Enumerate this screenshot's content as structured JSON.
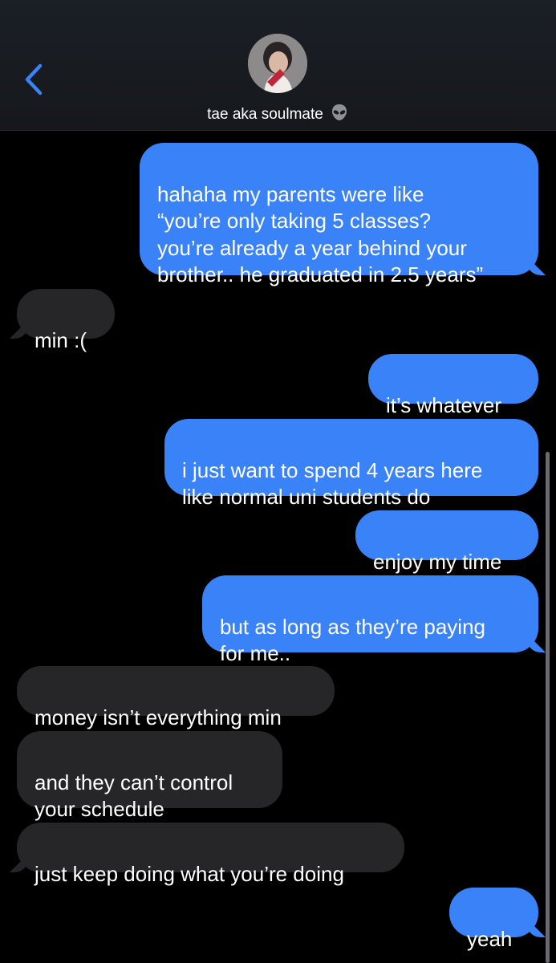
{
  "header": {
    "contact_name": "tae aka soulmate",
    "contact_emoji_icon": "alien-icon",
    "back_icon": "chevron-left-icon",
    "accent_color": "#3a82f7"
  },
  "messages": [
    {
      "from": "me",
      "text": "hahaha my parents were like\n“you’re only taking 5 classes?\nyou’re already a year behind your\nbrother.. he graduated in 2.5 years”"
    },
    {
      "from": "them",
      "text": "min :("
    },
    {
      "from": "me",
      "text": "it’s whatever"
    },
    {
      "from": "me",
      "text": "i just want to spend 4 years here\nlike normal uni students do"
    },
    {
      "from": "me",
      "text": "enjoy my time"
    },
    {
      "from": "me",
      "text": "but as long as they’re paying\nfor me.."
    },
    {
      "from": "them",
      "text": "money isn’t everything min"
    },
    {
      "from": "them",
      "text": "and they can’t control\nyour schedule"
    },
    {
      "from": "them",
      "text": "just keep doing what you’re doing"
    },
    {
      "from": "me",
      "text": "yeah"
    }
  ],
  "colors": {
    "sent_bubble": "#3a82f7",
    "received_bubble": "#262628",
    "background": "#000000"
  }
}
